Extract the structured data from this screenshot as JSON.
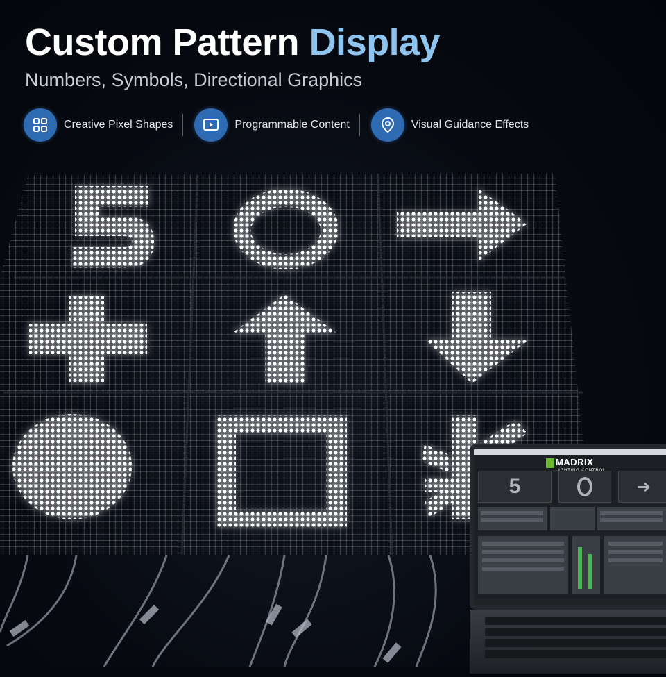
{
  "header": {
    "title_main": "Custom Pattern ",
    "title_accent": "Display",
    "subtitle": "Numbers, Symbols, Directional Graphics"
  },
  "features": [
    {
      "label": "Creative Pixel Shapes",
      "icon": "grid-icon"
    },
    {
      "label": "Programmable Content",
      "icon": "play-screen-icon"
    },
    {
      "label": "Visual Guidance Effects",
      "icon": "location-pin-icon"
    }
  ],
  "panels": [
    {
      "symbol": "5"
    },
    {
      "symbol": "circle-outline"
    },
    {
      "symbol": "arrow-right"
    },
    {
      "symbol": "plus"
    },
    {
      "symbol": "arrow-up"
    },
    {
      "symbol": "arrow-down"
    },
    {
      "symbol": "filled-circle"
    },
    {
      "symbol": "square-outline"
    },
    {
      "symbol": "burst"
    }
  ],
  "laptop": {
    "logo": "MADRIX",
    "logo_sub": "LIGHTING CONTROL",
    "preview_left": "5",
    "preview_right": "➜"
  },
  "colors": {
    "accent": "#8fc4ee",
    "icon_bg": "#2f6bb3",
    "led": "#eef6ff",
    "background": "#05070c"
  }
}
